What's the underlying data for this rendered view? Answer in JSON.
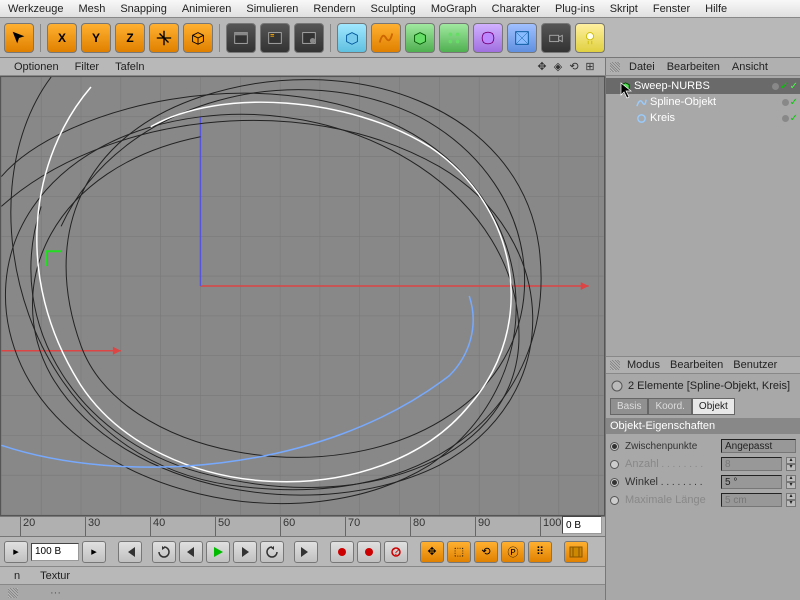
{
  "menu": [
    "Werkzeuge",
    "Mesh",
    "Snapping",
    "Animieren",
    "Simulieren",
    "Rendern",
    "Sculpting",
    "MoGraph",
    "Charakter",
    "Plug-ins",
    "Skript",
    "Fenster",
    "Hilfe"
  ],
  "submenu": {
    "items": [
      "Optionen",
      "Filter",
      "Tafeln"
    ]
  },
  "right_menu": {
    "file": "Datei",
    "edit": "Bearbeiten",
    "view": "Ansicht"
  },
  "hierarchy": [
    {
      "name": "Sweep-NURBS",
      "icon": "sweep",
      "indent": 0,
      "sel": true
    },
    {
      "name": "Spline-Objekt",
      "icon": "spline",
      "indent": 1,
      "sel": false
    },
    {
      "name": "Kreis",
      "icon": "circle",
      "indent": 1,
      "sel": false
    }
  ],
  "attr_menu": {
    "mode": "Modus",
    "edit": "Bearbeiten",
    "user": "Benutzer"
  },
  "attr": {
    "title": "2 Elemente [Spline-Objekt, Kreis]",
    "tabs": [
      "Basis",
      "Koord.",
      "Objekt"
    ],
    "active_tab": "Objekt",
    "section": "Objekt-Eigenschaften",
    "props": {
      "zwischen_lbl": "Zwischenpunkte",
      "zwischen_val": "Angepasst",
      "anzahl_lbl": "Anzahl",
      "anzahl_val": "8",
      "winkel_lbl": "Winkel",
      "winkel_val": "5 °",
      "maxlen_lbl": "Maximale Länge",
      "maxlen_val": "5 cm"
    }
  },
  "timeline": {
    "ticks": [
      20,
      30,
      40,
      50,
      60,
      70,
      80,
      90,
      100
    ],
    "current": "100 B",
    "end": "0 B"
  },
  "bottom": {
    "n": "n",
    "textur": "Textur"
  },
  "icons": {
    "x": "X",
    "y": "Y",
    "z": "Z"
  }
}
